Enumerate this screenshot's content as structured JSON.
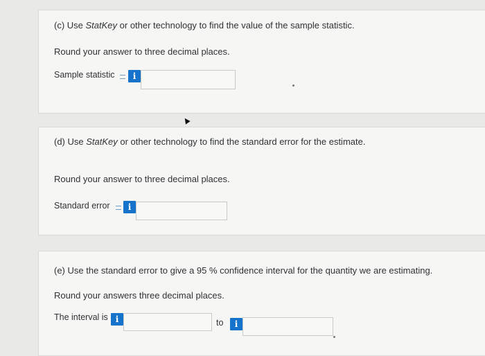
{
  "part_c": {
    "question_prefix": "(c) Use ",
    "question_italic": "StatKey",
    "question_suffix": " or other technology to find the value of the sample statistic.",
    "instruction": "Round your answer to three decimal places.",
    "field_label": "Sample statistic",
    "info_glyph": "i",
    "value": ""
  },
  "part_d": {
    "question_prefix": "(d) Use ",
    "question_italic": "StatKey",
    "question_suffix": " or other technology to find the standard error for the estimate.",
    "instruction": "Round your answer to three decimal places.",
    "field_label": "Standard error",
    "info_glyph": "i",
    "value": ""
  },
  "part_e": {
    "question": "(e) Use the standard error to give a 95 % confidence interval for the quantity we are estimating.",
    "instruction": "Round your answers three decimal places.",
    "field_label": "The interval is",
    "connector": "to",
    "info_glyph": "i",
    "lower_value": "",
    "upper_value": ""
  },
  "colors": {
    "info_button": "#1673cc",
    "panel_bg": "#f6f6f4",
    "page_bg": "#e9e9e7"
  },
  "icons": [
    "info-icon",
    "mouse-cursor-icon"
  ]
}
